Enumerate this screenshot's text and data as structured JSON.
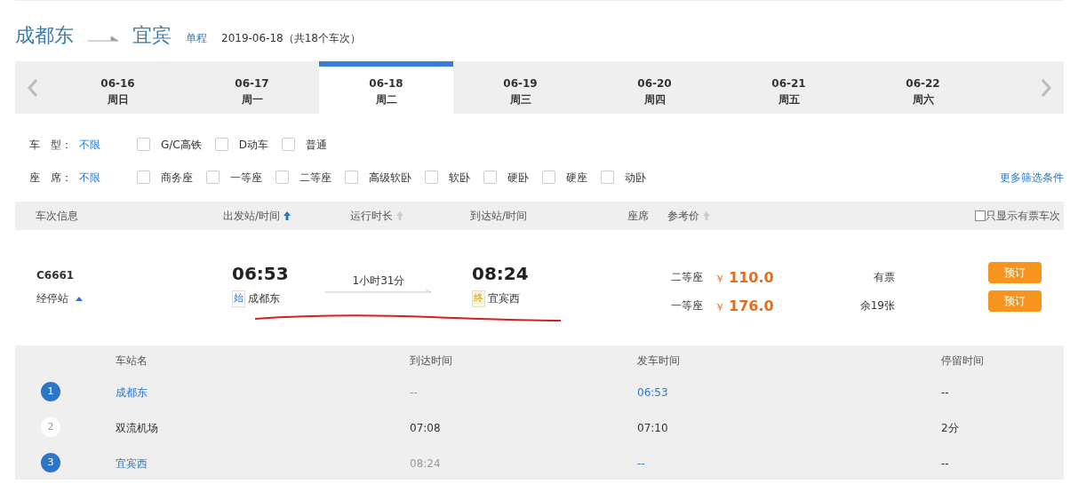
{
  "route": {
    "from": "成都东",
    "to": "宜宾",
    "trip_type": "单程",
    "summary": "2019-06-18（共18个车次）"
  },
  "dates": [
    {
      "date": "06-16",
      "weekday": "周日",
      "selected": false
    },
    {
      "date": "06-17",
      "weekday": "周一",
      "selected": false
    },
    {
      "date": "06-18",
      "weekday": "周二",
      "selected": true
    },
    {
      "date": "06-19",
      "weekday": "周三",
      "selected": false
    },
    {
      "date": "06-20",
      "weekday": "周四",
      "selected": false
    },
    {
      "date": "06-21",
      "weekday": "周五",
      "selected": false
    },
    {
      "date": "06-22",
      "weekday": "周六",
      "selected": false
    }
  ],
  "filters": [
    {
      "label": "车　型：",
      "all": "不限",
      "options": [
        {
          "label": "G/C高铁",
          "checked": false
        },
        {
          "label": "D动车",
          "checked": false
        },
        {
          "label": "普通",
          "checked": false
        }
      ]
    },
    {
      "label": "座　席：",
      "all": "不限",
      "options": [
        {
          "label": "商务座",
          "checked": false
        },
        {
          "label": "一等座",
          "checked": false
        },
        {
          "label": "二等座",
          "checked": false
        },
        {
          "label": "高级软卧",
          "checked": false
        },
        {
          "label": "软卧",
          "checked": false
        },
        {
          "label": "硬卧",
          "checked": false
        },
        {
          "label": "硬座",
          "checked": false
        },
        {
          "label": "动卧",
          "checked": false
        }
      ]
    }
  ],
  "more_filters": "更多筛选条件",
  "columns": [
    {
      "label": "车次信息",
      "kind": "plain"
    },
    {
      "label": "出发站/时间",
      "kind": "sorted"
    },
    {
      "label": "运行时长",
      "kind": "sortable"
    },
    {
      "label": "到达站/时间",
      "kind": "plain"
    },
    {
      "label": "座席",
      "kind": "plain"
    },
    {
      "label": "参考价",
      "kind": "sortable"
    }
  ],
  "only_available": {
    "label": "只显示有票车次",
    "checked": false
  },
  "train": {
    "number": "C6661",
    "stops_toggle": "经停站",
    "depart_time": "06:53",
    "depart_tag": "始",
    "depart_station": "成都东",
    "duration": "1小时31分",
    "arrive_time": "08:24",
    "arrive_tag": "终",
    "arrive_station": "宜宾西",
    "seats": [
      {
        "class": "二等座",
        "currency": "￥",
        "price": "110.0",
        "availability": "有票",
        "button": "预订"
      },
      {
        "class": "一等座",
        "currency": "￥",
        "price": "176.0",
        "availability": "余19张",
        "button": "预订"
      }
    ]
  },
  "stops": {
    "columns": [
      "车站名",
      "到达时间",
      "发车时间",
      "停留时间"
    ],
    "rows": [
      {
        "index": "1",
        "kind": "endpoint",
        "station": "成都东",
        "arrive": "--",
        "depart": "06:53",
        "stay": "--"
      },
      {
        "index": "2",
        "kind": "intermediate",
        "station": "双流机场",
        "arrive": "07:08",
        "depart": "07:10",
        "stay": "2分"
      },
      {
        "index": "3",
        "kind": "endpoint",
        "station": "宜宾西",
        "arrive": "08:24",
        "depart": "--",
        "stay": "--"
      }
    ]
  }
}
